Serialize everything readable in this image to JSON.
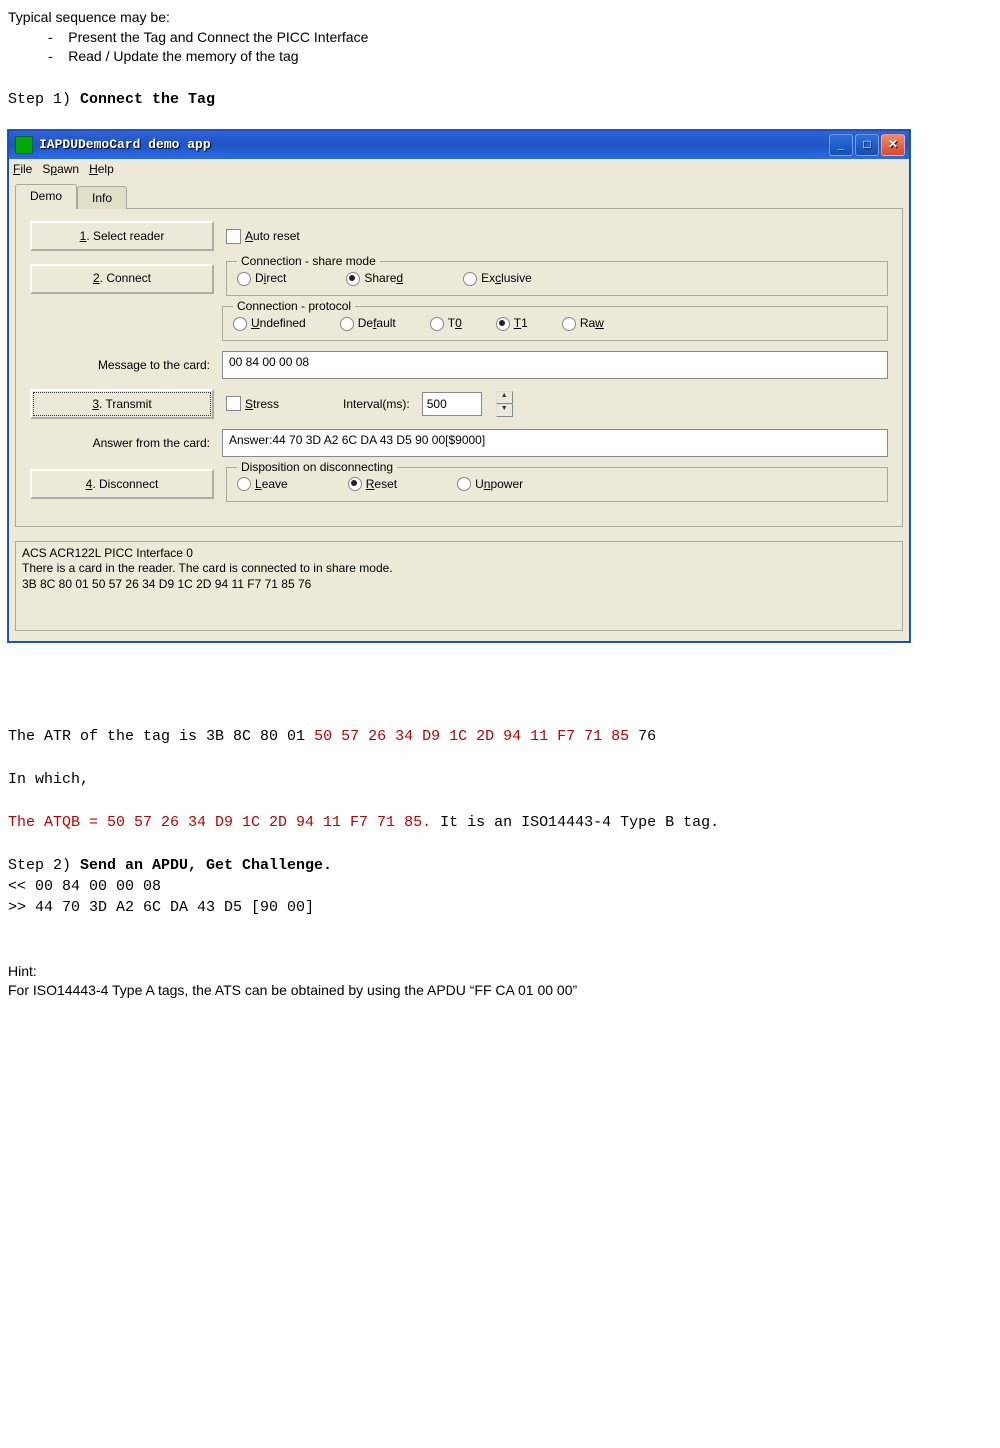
{
  "doc": {
    "intro": "Typical sequence may be:",
    "bullets": [
      "Present the Tag and Connect the PICC Interface",
      "Read / Update the memory of the tag"
    ],
    "step1_prefix": "Step 1) ",
    "step1_bold": "Connect the Tag",
    "atr_prefix": "The ATR of the tag is 3B 8C 80 01 ",
    "atr_red": "50 57 26 34 D9 1C 2D 94 11 F7 71 85",
    "atr_suffix": " 76",
    "in_which": "In which,",
    "atqb_red": "The ATQB = 50 57 26 34 D9 1C 2D 94 11 F7 71 85.",
    "atqb_suffix": " It is an ISO14443-4 Type B tag.",
    "step2_prefix": "Step 2) ",
    "step2_bold": "Send an APDU, Get Challenge.",
    "apdu_sent": "<< 00 84 00 00 08",
    "apdu_recv": ">> 44 70 3D A2 6C DA 43 D5 [90 00]",
    "hint_label": "Hint:",
    "hint_text": "For ISO14443-4 Type A tags, the ATS can be obtained by using the APDU “FF CA 01 00 00”"
  },
  "win": {
    "title": "IAPDUDemoCard demo app",
    "menus": [
      "File",
      "Spawn",
      "Help"
    ],
    "tabs": [
      "Demo",
      "Info"
    ],
    "buttons": {
      "select_reader": "1. Select reader",
      "connect": "2. Connect",
      "transmit": "3. Transmit",
      "disconnect": "4. Disconnect"
    },
    "auto_reset": "Auto reset",
    "share_legend": "Connection - share mode",
    "shares": [
      "Direct",
      "Shared",
      "Exclusive"
    ],
    "share_selected": 1,
    "proto_legend": "Connection - protocol",
    "protos": [
      "Undefined",
      "Default",
      "T0",
      "T1",
      "Raw"
    ],
    "proto_selected": 3,
    "msg_label": "Message to the card:",
    "msg_value": "00 84 00 00 08",
    "stress": "Stress",
    "interval_label": "Interval(ms):",
    "interval_value": "500",
    "ans_label": "Answer from the card:",
    "ans_value": "Answer:44 70 3D A2 6C DA 43 D5 90 00[$9000]",
    "disp_legend": "Disposition on disconnecting",
    "disps": [
      "Leave",
      "Reset",
      "Unpower"
    ],
    "disp_selected": 1,
    "status": [
      "ACS ACR122L PICC Interface 0",
      "There is a card in the reader. The card is connected to in share mode.",
      "3B 8C 80 01 50 57 26 34 D9 1C 2D 94 11 F7 71 85 76"
    ]
  }
}
